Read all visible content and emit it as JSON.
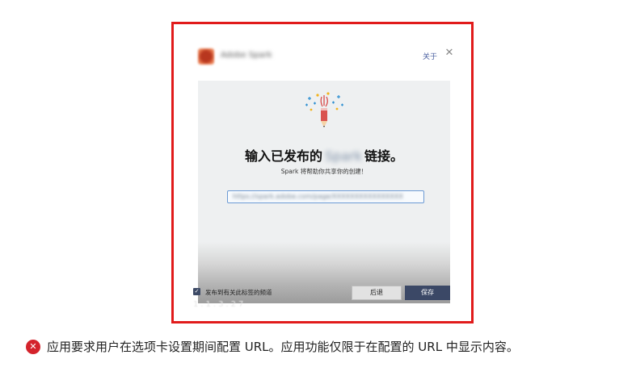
{
  "dialog": {
    "app_name": "Adobe Spark",
    "about_link": "关于",
    "close_glyph": "✕",
    "headline_prefix": "输入已发布的",
    "headline_blurred": "Spark",
    "headline_suffix": "链接。",
    "subline": "Spark 将帮助你共享你的创建！",
    "url_value": "https://spark.adobe.com/page/XXXXXXXXXXXXXXXX",
    "footer": {
      "checkbox_glyph": "✓",
      "checkbox_label": "发布到有关此标签的频道",
      "back_label": "后退",
      "save_label": "保存"
    },
    "ghost_text": "1.1.3.27"
  },
  "caption": {
    "icon_glyph": "✕",
    "text": "应用要求用户在选项卡设置期间配置 URL。应用功能仅限于在配置的 URL 中显示内容。"
  },
  "colors": {
    "frame_border": "#e11b1b",
    "caption_icon": "#d4232b",
    "save_button": "#3b4866"
  }
}
